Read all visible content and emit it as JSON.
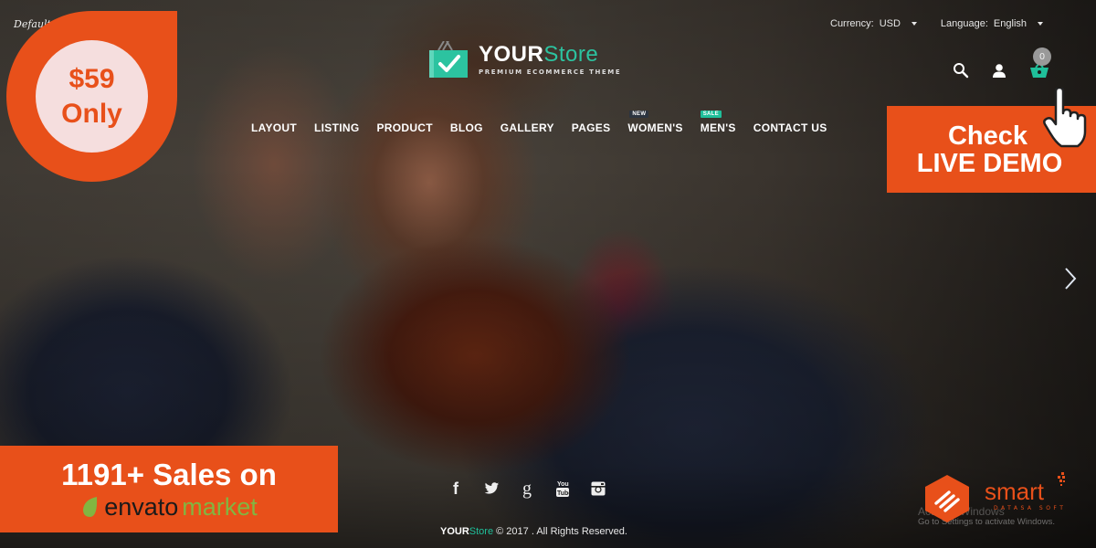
{
  "hero": {
    "image_description": "bearded man in navy cable-knit sweater"
  },
  "header": {
    "default_label": "Default",
    "currency": {
      "label": "Currency:",
      "value": "USD"
    },
    "language": {
      "label": "Language:",
      "value": "English"
    },
    "cart_count": "0"
  },
  "logo": {
    "title_your": "YOUR",
    "title_store": "Store",
    "subtitle": "PREMIUM ECOMMERCE THEME"
  },
  "nav": {
    "items": [
      {
        "label": "LAYOUT"
      },
      {
        "label": "LISTING"
      },
      {
        "label": "PRODUCT"
      },
      {
        "label": "BLOG"
      },
      {
        "label": "GALLERY"
      },
      {
        "label": "PAGES"
      },
      {
        "label": "WOMEN'S",
        "badge": "NEW"
      },
      {
        "label": "MEN'S",
        "badge": "SALE"
      },
      {
        "label": "CONTACT US"
      }
    ]
  },
  "promo": {
    "price": "$59",
    "price_suffix": "Only",
    "live_demo_line1": "Check",
    "live_demo_line2": "LIVE DEMO",
    "sales_text": "1191+ Sales on",
    "envato_word1": "envato",
    "envato_word2": "market"
  },
  "footer": {
    "social": [
      "facebook",
      "twitter",
      "google-plus",
      "youtube",
      "instagram"
    ],
    "copyright_your": "YOUR",
    "copyright_store": "Store",
    "copyright_text": " © 2017 . All Rights Reserved."
  },
  "watermark": {
    "brand": "smart",
    "brand_sub": "DATASA SOFT",
    "windows_line1": "Activate Windows",
    "windows_line2": "Go to Settings to activate Windows."
  },
  "colors": {
    "accent_orange": "#e8501a",
    "brand_teal": "#2cc3a0",
    "envato_green": "#82b541"
  }
}
